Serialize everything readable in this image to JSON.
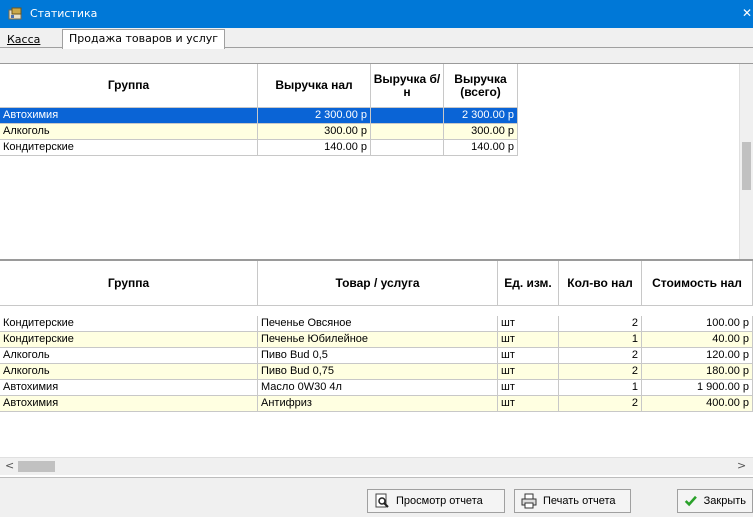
{
  "window": {
    "title": "Статистика"
  },
  "tabs": [
    {
      "label": "Касса"
    },
    {
      "label": "Продажа товаров и услуг",
      "active": true
    }
  ],
  "groups_table": {
    "headers": [
      "Группа",
      "Выручка нал",
      "Выручка б/н",
      "Выручка (всего)"
    ],
    "rows": [
      {
        "group": "Автохимия",
        "cash": "2 300.00 р",
        "noncash": "",
        "total": "2 300.00 р",
        "selected": true
      },
      {
        "group": "Алкоголь",
        "cash": "300.00 р",
        "noncash": "",
        "total": "300.00 р"
      },
      {
        "group": "Кондитерские",
        "cash": "140.00 р",
        "noncash": "",
        "total": "140.00 р"
      }
    ]
  },
  "items_table": {
    "headers": [
      "Группа",
      "Товар / услуга",
      "Ед. изм.",
      "Кол-во нал",
      "Стоимость нал"
    ],
    "rows": [
      {
        "group": "Кондитерские",
        "item": "Печенье Овсяное",
        "unit": "шт",
        "qty": "2",
        "cost": "100.00 р"
      },
      {
        "group": "Кондитерские",
        "item": "Печенье Юбилейное",
        "unit": "шт",
        "qty": "1",
        "cost": "40.00 р"
      },
      {
        "group": "Алкоголь",
        "item": "Пиво Bud 0,5",
        "unit": "шт",
        "qty": "2",
        "cost": "120.00 р"
      },
      {
        "group": "Алкоголь",
        "item": "Пиво Bud 0,75",
        "unit": "шт",
        "qty": "2",
        "cost": "180.00 р"
      },
      {
        "group": "Автохимия",
        "item": "Масло 0W30 4л",
        "unit": "шт",
        "qty": "1",
        "cost": "1 900.00 р"
      },
      {
        "group": "Автохимия",
        "item": "Антифриз",
        "unit": "шт",
        "qty": "2",
        "cost": "400.00 р"
      }
    ]
  },
  "buttons": {
    "preview": "Просмотр отчета",
    "print": "Печать отчета",
    "close": "Закрыть"
  },
  "colors": {
    "titlebar": "#0078d7",
    "selection": "#0a64d6",
    "alt_row": "#ffffe1",
    "check": "#2aa12a"
  }
}
